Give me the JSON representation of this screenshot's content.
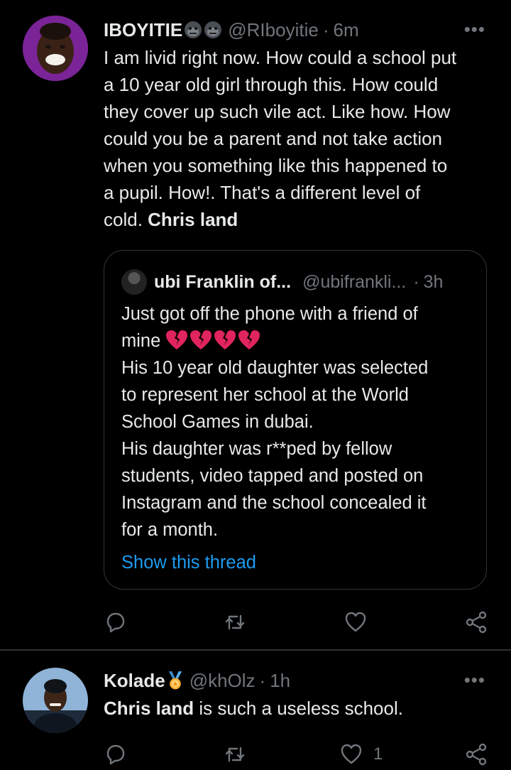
{
  "tweet1": {
    "name": "IBOYITIE",
    "name_emojis": [
      "gorilla-emoji",
      "gorilla-emoji"
    ],
    "handle": "@RIboyitie",
    "separator": "·",
    "time": "6m",
    "more": "•••",
    "lines": [
      "I am livid right now. How could a school put",
      "a 10 year old girl through this. How could",
      "they cover up such vile act. Like how. How",
      "could you be a parent and not take action",
      "when you something like this happened to",
      "a pupil. How!. That's a different level of"
    ],
    "last_line_plain": "cold. ",
    "last_line_bold": "Chris land",
    "quoted": {
      "name": "ubi Franklin of...",
      "handle": "@ubifrankli...",
      "separator": "·",
      "time": "3h",
      "line1": "Just got off the phone with a friend of",
      "line2_prefix": "mine ",
      "broken_hearts": 4,
      "lines": [
        "His 10 year old daughter was selected",
        "to represent her school  at the World",
        "School Games in dubai.",
        "His daughter was r**ped by fellow",
        "students, video tapped and posted on",
        "Instagram and the school concealed it",
        "for a month."
      ],
      "show_thread": "Show this thread"
    },
    "actions": {
      "reply": "",
      "retweet": "",
      "like": "",
      "share": ""
    }
  },
  "tweet2": {
    "name": "Kolade",
    "name_emoji": "medal-emoji",
    "handle": "@khOlz",
    "separator": "·",
    "time": "1h",
    "more": "•••",
    "text_bold": "Chris land",
    "text_plain": " is such a useless school.",
    "actions": {
      "reply": "",
      "retweet": "",
      "like": "1",
      "share": ""
    }
  },
  "colors": {
    "background": "#000000",
    "text": "#e7e9ea",
    "muted": "#71767b",
    "link": "#1d9bf0",
    "border": "#2f3336",
    "heart": "#e0245e"
  }
}
